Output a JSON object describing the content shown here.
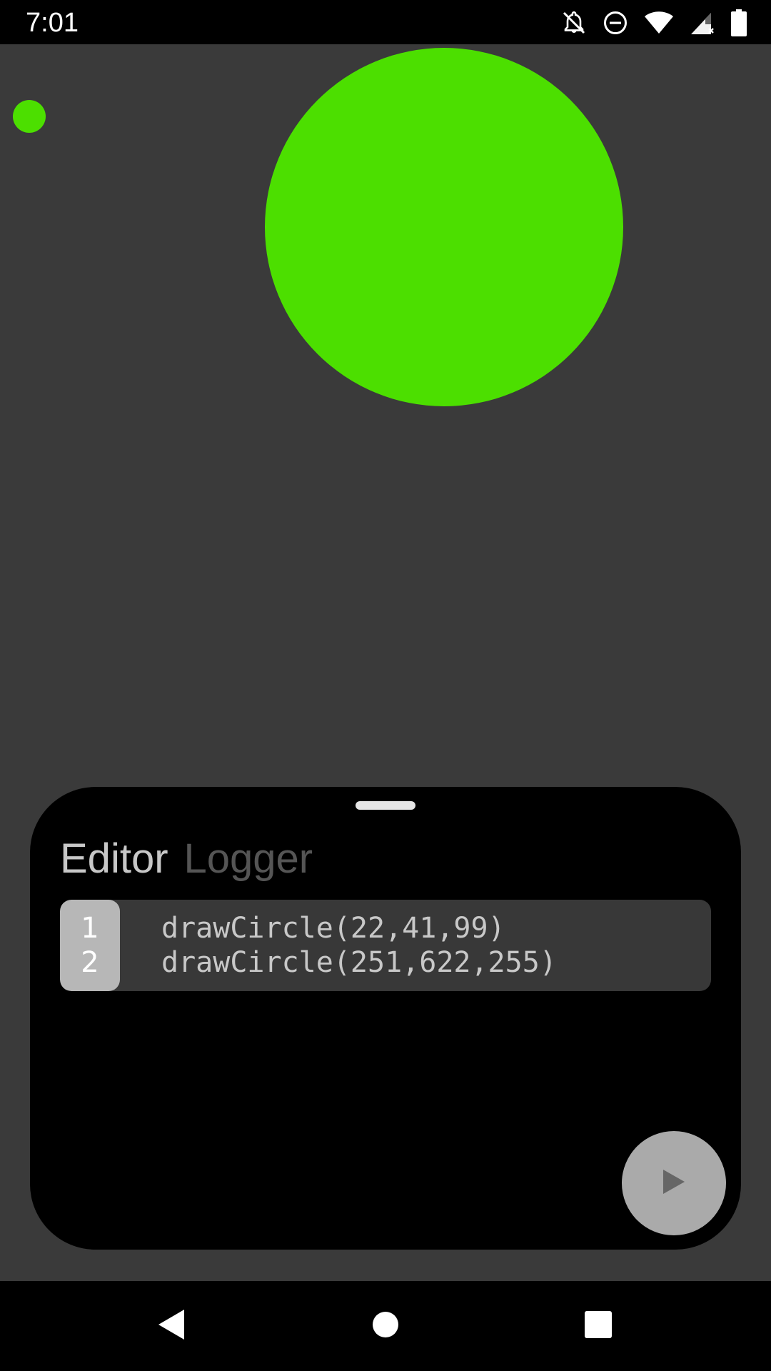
{
  "status_bar": {
    "time": "7:01",
    "icons": [
      "notifications-off-icon",
      "do-not-disturb-icon",
      "wifi-icon",
      "signal-icon",
      "battery-icon"
    ]
  },
  "canvas": {
    "circle_color": "#4cdf00",
    "background_color": "#3a3a3a"
  },
  "sheet": {
    "tabs": [
      {
        "label": "Editor",
        "active": true
      },
      {
        "label": "Logger",
        "active": false
      }
    ],
    "code_lines": [
      {
        "number": "1",
        "text": "drawCircle(22,41,99)"
      },
      {
        "number": "2",
        "text": "drawCircle(251,622,255)"
      }
    ],
    "run_button_icon": "play-icon"
  },
  "nav_bar": {
    "icons": [
      "back-icon",
      "home-icon",
      "recents-icon"
    ]
  }
}
